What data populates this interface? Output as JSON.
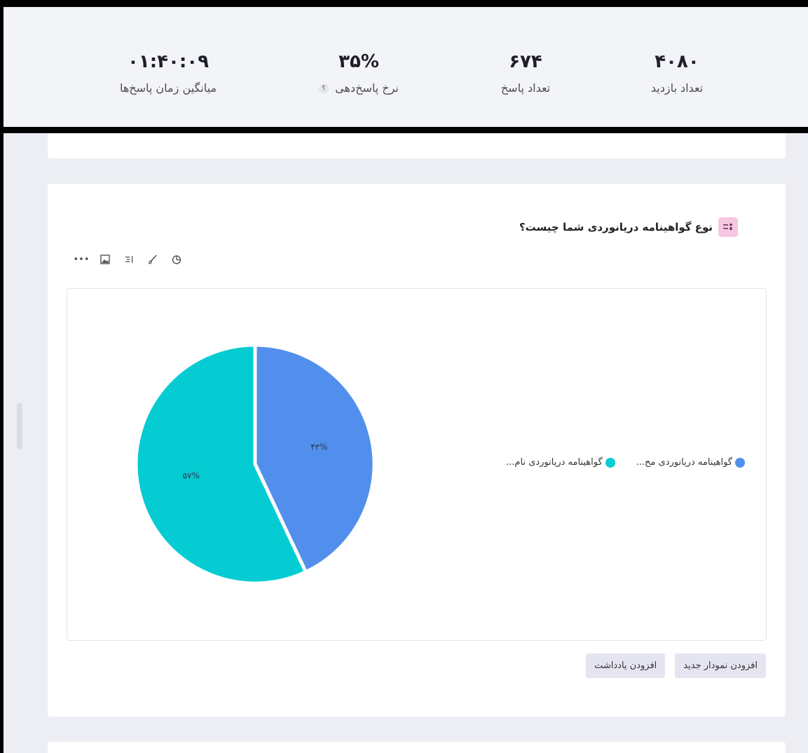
{
  "stats": [
    {
      "value": "۴۰۸۰",
      "label": "تعداد بازدید"
    },
    {
      "value": "۶۷۴",
      "label": "تعداد پاسخ"
    },
    {
      "value": "۳۵%",
      "label": "نرخ پاسخ‌دهی",
      "help": "؟"
    },
    {
      "value": "۰۱:۴۰:۰۹",
      "label": "میانگین زمان پاسخ‌ها"
    }
  ],
  "question": {
    "title": "نوع گواهینامه دریانوردی شما چیست؟",
    "icon": "question-list-icon",
    "badge_color": "#f7c7e2"
  },
  "toolbar": {
    "icons": [
      "chart-type-icon",
      "brush-icon",
      "sort-icon",
      "image-icon",
      "more-icon"
    ]
  },
  "chart_data": {
    "type": "pie",
    "series": [
      {
        "name": "گواهینامه دریانوردی مح...",
        "value": 43,
        "label": "۴۳%",
        "color": "#528fec"
      },
      {
        "name": "گواهینامه دریانوردی نام...",
        "value": 57,
        "label": "۵۷%",
        "color": "#05ccd2"
      }
    ],
    "legend_position": "right"
  },
  "buttons": {
    "add_chart": "افزودن نمودار جدید",
    "add_note": "افزودن یادداشت"
  }
}
